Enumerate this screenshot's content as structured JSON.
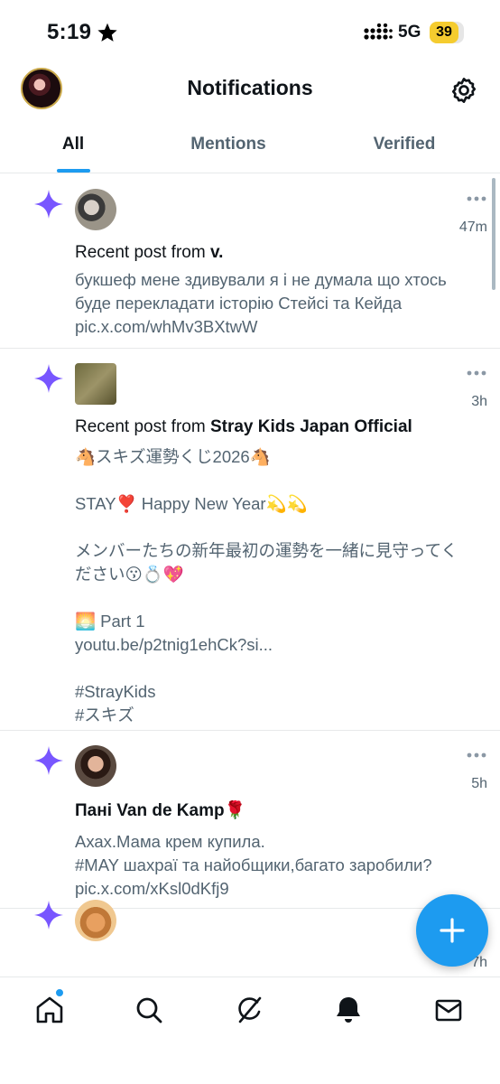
{
  "status_bar": {
    "time": "5:19",
    "network": "5G",
    "battery_level": "39",
    "battery_color": "#f5cc2f"
  },
  "header": {
    "title": "Notifications",
    "settings_icon": "gear-icon"
  },
  "tabs": [
    {
      "label": "All",
      "active": true
    },
    {
      "label": "Mentions",
      "active": false
    },
    {
      "label": "Verified",
      "active": false
    }
  ],
  "notifications": [
    {
      "icon": "sparkle-icon",
      "time": "47m",
      "prefix": "Recent post from ",
      "author": "v.",
      "lines": [
        "букшеф мене здивували я і не думала що хтось",
        "буде перекладати історію Стейсі та Кейда",
        "pic.x.com/whMv3BXtwW"
      ]
    },
    {
      "icon": "sparkle-icon",
      "time": "3h",
      "prefix": "Recent post from ",
      "author": "Stray Kids Japan Official",
      "lines": [
        "🐴スキズ運勢くじ2026🐴",
        "",
        "STAY❣️ Happy New Year💫💫",
        "",
        "メンバーたちの新年最初の運勢を一緒に見守ってく",
        "ださい😗💍💖",
        "",
        "🌅 Part 1",
        "youtu.be/p2tnig1ehCk?si...",
        "",
        "#StrayKids",
        "#スキズ"
      ]
    },
    {
      "icon": "sparkle-icon",
      "time": "5h",
      "prefix": "",
      "author": "Пані Van de Kamp🌹",
      "lines": [
        "Ахах.Мама крем купила.",
        "#MAY шахраї та найобщики,багато заробили?",
        "pic.x.com/xKsl0dKfj9"
      ]
    },
    {
      "icon": "sparkle-icon",
      "time": "7h",
      "prefix": "",
      "author": "",
      "lines": []
    }
  ],
  "fab": {
    "icon": "plus-icon",
    "color": "#1d9bf0"
  },
  "bottom_nav": [
    {
      "name": "home-icon",
      "has_dot": true
    },
    {
      "name": "search-icon",
      "has_dot": false
    },
    {
      "name": "grok-icon",
      "has_dot": false
    },
    {
      "name": "bell-icon",
      "has_dot": false
    },
    {
      "name": "mail-icon",
      "has_dot": false
    }
  ],
  "colors": {
    "accent": "#1d9bf0",
    "sparkle": "#7856ff",
    "secondary_text": "#536471"
  }
}
